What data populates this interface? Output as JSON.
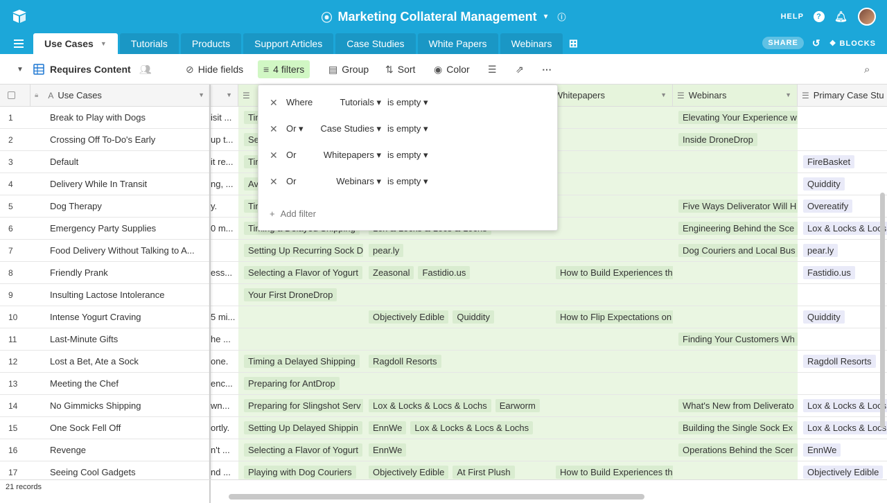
{
  "app": {
    "title": "Marketing Collateral Management",
    "help_label": "HELP",
    "share_label": "SHARE",
    "blocks_label": "BLOCKS"
  },
  "tabs": [
    "Use Cases",
    "Tutorials",
    "Products",
    "Support Articles",
    "Case Studies",
    "White Papers",
    "Webinars"
  ],
  "viewbar": {
    "view_name": "Requires Content",
    "hide_fields": "Hide fields",
    "filters": "4 filters",
    "group": "Group",
    "sort": "Sort",
    "color": "Color"
  },
  "filters": [
    {
      "conj": "Where",
      "field": "Tutorials",
      "op": "is empty"
    },
    {
      "conj": "Or",
      "field": "Case Studies",
      "op": "is empty"
    },
    {
      "conj": "Or",
      "field": "Whitepapers",
      "op": "is empty"
    },
    {
      "conj": "Or",
      "field": "Webinars",
      "op": "is empty"
    }
  ],
  "add_filter": "Add filter",
  "columns": {
    "primary": "Use Cases",
    "whitepapers": "Whitepapers",
    "webinars": "Webinars",
    "primary_case": "Primary Case Stu"
  },
  "rows": [
    {
      "n": "1",
      "name": "Break to Play with Dogs",
      "b": "isit ...",
      "t": "Tim",
      "c": [],
      "w": "",
      "web": "Elevating Your Experience w",
      "p": ""
    },
    {
      "n": "2",
      "name": "Crossing Off To-Do's Early",
      "b": "up t...",
      "t": "Sel",
      "c": [],
      "w": "",
      "web": "Inside DroneDrop",
      "p": ""
    },
    {
      "n": "3",
      "name": "Default",
      "b": "it re...",
      "t": "Tim",
      "c": [],
      "w": "",
      "web": "",
      "p": "FireBasket"
    },
    {
      "n": "4",
      "name": "Delivery While In Transit",
      "b": "ng, ...",
      "t": "Avo",
      "c": [],
      "w": "",
      "web": "",
      "p": "Quiddity"
    },
    {
      "n": "5",
      "name": "Dog Therapy",
      "b": "y.",
      "t": "Tim",
      "c": [],
      "w": "",
      "web": "Five Ways Deliverator Will H",
      "p": "Overeatify"
    },
    {
      "n": "6",
      "name": "Emergency Party Supplies",
      "b": "0 m...",
      "t": "Timing a Delayed Shipping",
      "c": [
        "Lox & Locks & Locs & Lochs"
      ],
      "w": "",
      "web": "Engineering Behind the Sce",
      "p": "Lox & Locks & Locs"
    },
    {
      "n": "7",
      "name": "Food Delivery Without Talking to A...",
      "b": "",
      "t": "Setting Up Recurring Sock D",
      "c": [
        "pear.ly"
      ],
      "w": "",
      "web": "Dog Couriers and Local Bus",
      "p": "pear.ly"
    },
    {
      "n": "8",
      "name": "Friendly Prank",
      "b": "ess...",
      "t": "Selecting a Flavor of Yogurt",
      "c": [
        "Zeasonal",
        "Fastidio.us"
      ],
      "w": "How to Build Experiences th",
      "web": "",
      "p": "Fastidio.us"
    },
    {
      "n": "9",
      "name": "Insulting Lactose Intolerance",
      "b": "",
      "t": "Your First DroneDrop",
      "c": [],
      "w": "",
      "web": "",
      "p": ""
    },
    {
      "n": "10",
      "name": "Intense Yogurt Craving",
      "b": "5 mi...",
      "t": "",
      "c": [
        "Objectively Edible",
        "Quiddity"
      ],
      "w": "How to Flip Expectations on",
      "web": "",
      "p": "Quiddity"
    },
    {
      "n": "11",
      "name": "Last-Minute Gifts",
      "b": "he ...",
      "t": "",
      "c": [],
      "w": "",
      "web": "Finding Your Customers Wh",
      "p": ""
    },
    {
      "n": "12",
      "name": "Lost a Bet, Ate a Sock",
      "b": "one.",
      "t": "Timing a Delayed Shipping",
      "c": [
        "Ragdoll Resorts"
      ],
      "w": "",
      "web": "",
      "p": "Ragdoll Resorts"
    },
    {
      "n": "13",
      "name": "Meeting the Chef",
      "b": "enc...",
      "t": "Preparing for AntDrop",
      "c": [],
      "w": "",
      "web": "",
      "p": ""
    },
    {
      "n": "14",
      "name": "No Gimmicks Shipping",
      "b": "wn...",
      "t": "Preparing for Slingshot Serv",
      "c": [
        "Lox & Locks & Locs & Lochs",
        "Earworm"
      ],
      "w": "",
      "web": "What's New from Deliverato",
      "p": "Lox & Locks & Locs"
    },
    {
      "n": "15",
      "name": "One Sock Fell Off",
      "b": "ortly.",
      "t": "Setting Up Delayed Shippin",
      "c": [
        "EnnWe",
        "Lox & Locks & Locs & Lochs"
      ],
      "w": "",
      "web": "Building the Single Sock Ex",
      "p": "Lox & Locks & Locs"
    },
    {
      "n": "16",
      "name": "Revenge",
      "b": "n't ...",
      "t": "Selecting a Flavor of Yogurt",
      "c": [
        "EnnWe"
      ],
      "w": "",
      "web": "Operations Behind the Scer",
      "p": "EnnWe"
    },
    {
      "n": "17",
      "name": "Seeing Cool Gadgets",
      "b": "nd ...",
      "t": "Playing with Dog Couriers",
      "c": [
        "Objectively Edible",
        "At First Plush"
      ],
      "w": "How to Build Experiences th",
      "web": "",
      "p": "Objectively Edible"
    }
  ],
  "footer": {
    "records": "21 records"
  }
}
